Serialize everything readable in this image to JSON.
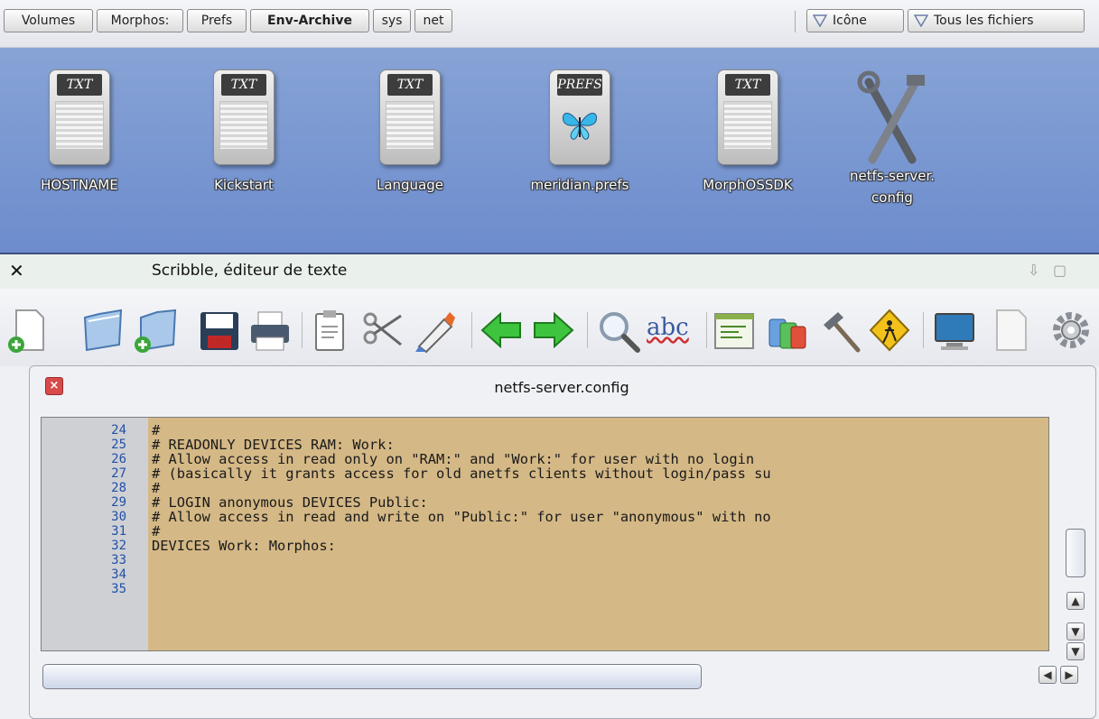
{
  "pathbar": {
    "crumbs": [
      "Volumes",
      "Morphos:",
      "Prefs",
      "Env-Archive",
      "sys",
      "net"
    ],
    "view_buttons": [
      "Icône",
      "Tous les fichiers"
    ]
  },
  "icons": [
    {
      "label": "HOSTNAME",
      "tag": "TXT",
      "kind": "text-file-icon"
    },
    {
      "label": "Kickstart",
      "tag": "TXT",
      "kind": "text-file-icon"
    },
    {
      "label": "Language",
      "tag": "TXT",
      "kind": "text-file-icon"
    },
    {
      "label": "meridian.prefs",
      "tag": "PREFS",
      "kind": "prefs-file-icon"
    },
    {
      "label": "MorphOSSDK",
      "tag": "TXT",
      "kind": "text-file-icon"
    },
    {
      "label": "netfs-server.",
      "label2": "config",
      "kind": "tools-icon"
    }
  ],
  "window": {
    "title": "Scribble, éditeur de texte",
    "close_glyph": "✕"
  },
  "toolbar": [
    "new-document-icon",
    "open-folder-icon",
    "new-folder-icon",
    "save-icon",
    "print-icon",
    "clipboard-icon",
    "scissors-icon",
    "glue-icon",
    "back-arrow-icon",
    "forward-arrow-icon",
    "search-icon",
    "spellcheck-icon",
    "script-icon",
    "tags-icon",
    "hammer-icon",
    "warning-icon",
    "monitor-icon",
    "document-icon",
    "gear-icon"
  ],
  "spellcheck_text": "abc",
  "document": {
    "name": "netfs-server.config",
    "lines": [
      {
        "no": "24",
        "text": "#"
      },
      {
        "no": "25",
        "text": "# READONLY DEVICES RAM: Work:"
      },
      {
        "no": "26",
        "text": "# Allow access in read only on \"RAM:\" and \"Work:\" for user with no login"
      },
      {
        "no": "27",
        "text": "# (basically it grants access for old anetfs clients without login/pass su"
      },
      {
        "no": "28",
        "text": "#"
      },
      {
        "no": "29",
        "text": "# LOGIN anonymous DEVICES Public:"
      },
      {
        "no": "30",
        "text": "# Allow access in read and write on \"Public:\" for user \"anonymous\" with no"
      },
      {
        "no": "31",
        "text": "#"
      },
      {
        "no": "32",
        "text": "DEVICES Work: Morphos:"
      },
      {
        "no": "33",
        "text": ""
      },
      {
        "no": "34",
        "text": ""
      },
      {
        "no": "35",
        "text": ""
      }
    ]
  },
  "colors": {
    "icon_pane": "#7a98d2",
    "editor_bg": "#d4b886",
    "gutter_bg": "#cfd0d4",
    "line_numbers": "#2050a8"
  }
}
